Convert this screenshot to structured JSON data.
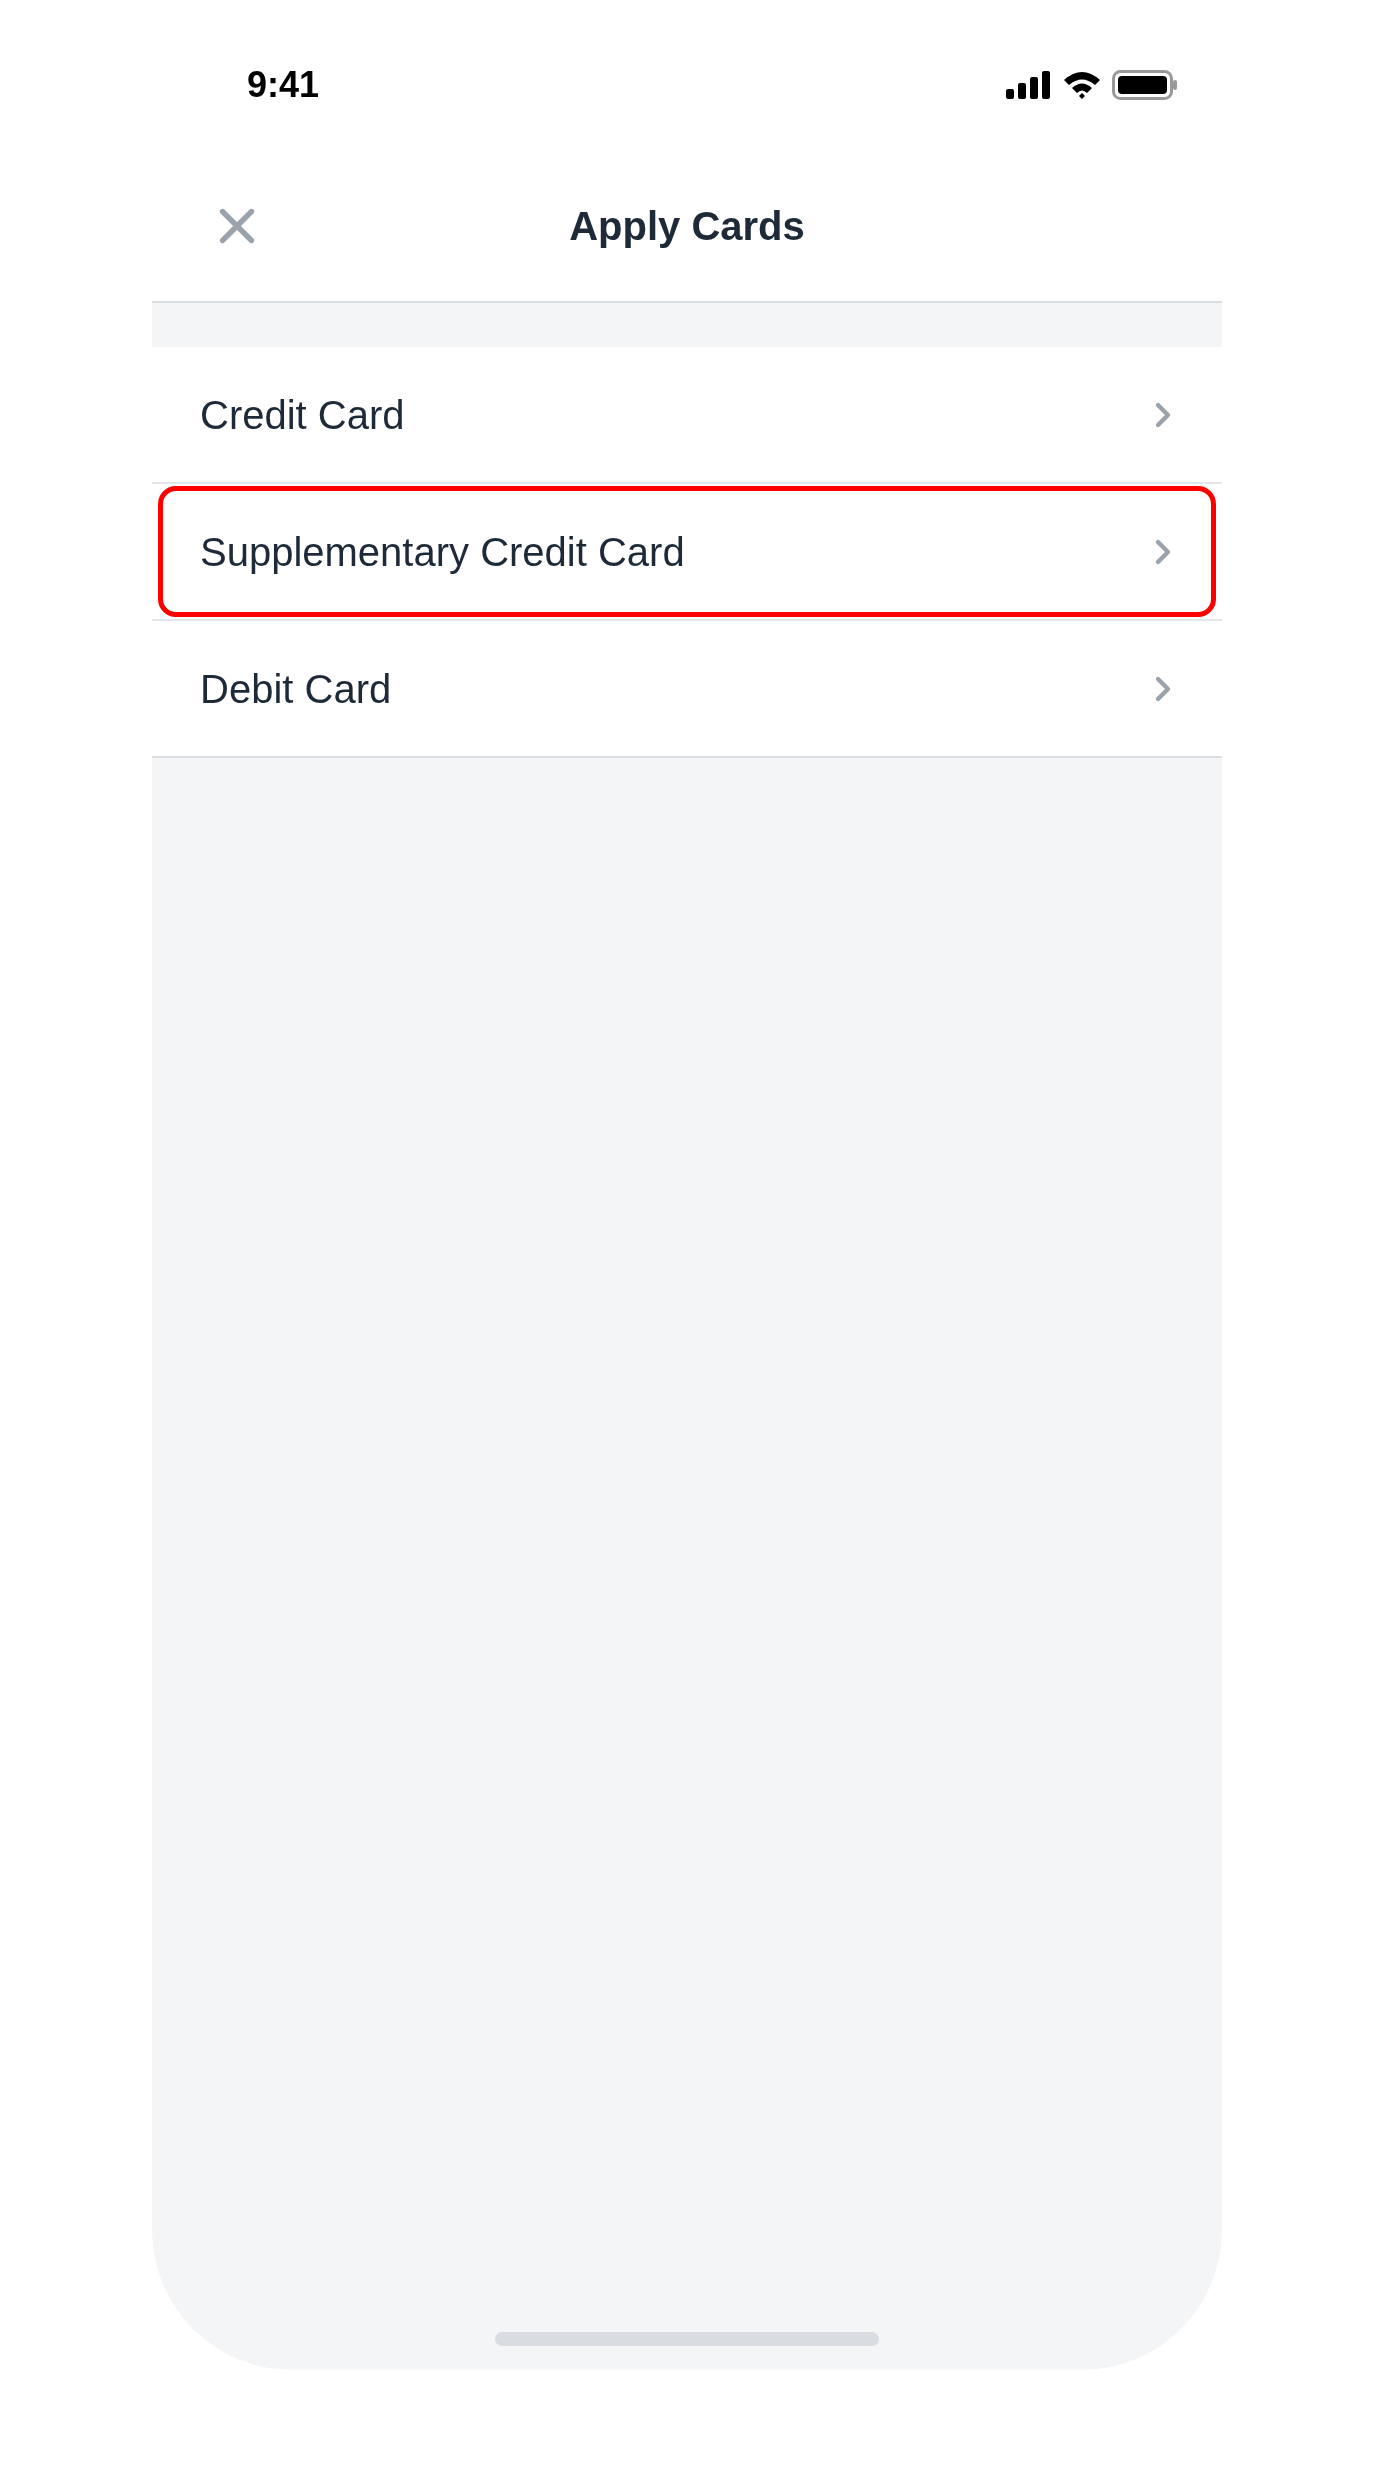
{
  "status_bar": {
    "time": "9:41"
  },
  "nav": {
    "title": "Apply Cards"
  },
  "rows": [
    {
      "label": "Credit Card",
      "selected": false
    },
    {
      "label": "Supplementary Credit Card",
      "selected": true
    },
    {
      "label": "Debit Card",
      "selected": false
    }
  ]
}
